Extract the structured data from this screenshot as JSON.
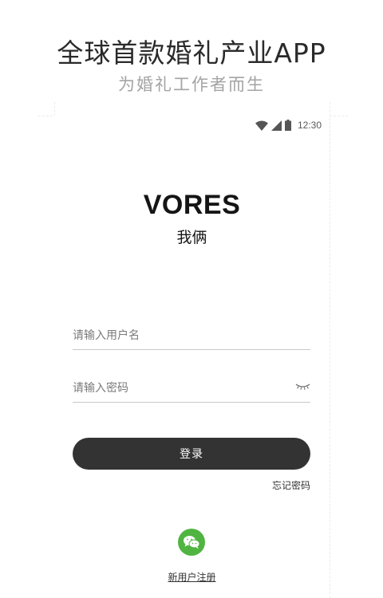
{
  "promo": {
    "title": "全球首款婚礼产业APP",
    "subtitle": "为婚礼工作者而生"
  },
  "status_bar": {
    "time": "12:30",
    "icons": [
      "wifi-icon",
      "cell-signal-icon",
      "battery-icon"
    ]
  },
  "brand": {
    "logo": "VORES",
    "logo_sub": "我俩"
  },
  "form": {
    "username_placeholder": "请输入用户名",
    "password_placeholder": "请输入密码",
    "password_toggle_icon": "eye-closed-icon",
    "login_label": "登录",
    "forgot_label": "忘记密码"
  },
  "social": {
    "wechat_icon": "wechat-icon",
    "wechat_color": "#50b441"
  },
  "register_label": "新用户注册",
  "colors": {
    "button": "#333333",
    "subtitle": "#a4a4a4"
  }
}
